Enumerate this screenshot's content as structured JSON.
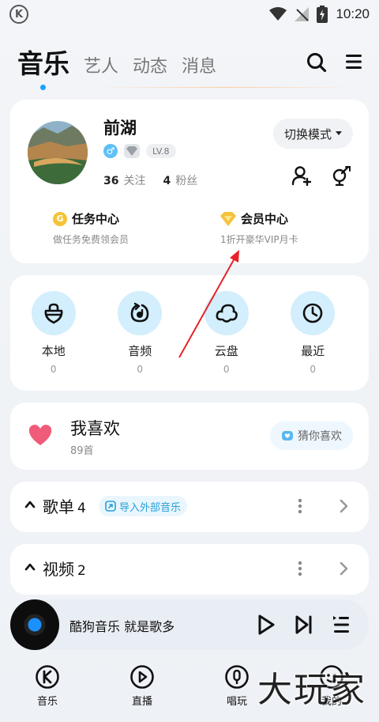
{
  "status_bar": {
    "time": "10:20"
  },
  "top_tabs": {
    "active": "音乐",
    "others": [
      "艺人",
      "动态",
      "消息"
    ]
  },
  "profile": {
    "username": "前湖",
    "level": "LV.8",
    "following_count": "36",
    "following_label": "关注",
    "fans_count": "4",
    "fans_label": "粉丝",
    "mode_button": "切换模式",
    "tasks": [
      {
        "title": "任务中心",
        "subtitle": "做任务免费领会员",
        "icon": "coin-icon"
      },
      {
        "title": "会员中心",
        "subtitle": "1折开豪华VIP月卡",
        "icon": "diamond-icon"
      }
    ]
  },
  "quick_access": [
    {
      "label": "本地",
      "count": "0",
      "icon": "bag-icon"
    },
    {
      "label": "音频",
      "count": "0",
      "icon": "audio-icon"
    },
    {
      "label": "云盘",
      "count": "0",
      "icon": "cloud-icon"
    },
    {
      "label": "最近",
      "count": "0",
      "icon": "clock-icon"
    }
  ],
  "favorites": {
    "title": "我喜欢",
    "count": "89首",
    "guess_button": "猜你喜欢"
  },
  "song_list": {
    "title": "歌单",
    "count": "4",
    "import_label": "导入外部音乐"
  },
  "video": {
    "title": "视频",
    "count": "2"
  },
  "player": {
    "title": "酷狗音乐  就是歌多"
  },
  "bottom_nav": [
    {
      "label": "音乐",
      "icon": "kugou-icon"
    },
    {
      "label": "直播",
      "icon": "live-icon"
    },
    {
      "label": "唱玩",
      "icon": "mic-icon"
    },
    {
      "label": "我的",
      "icon": "profile-icon"
    }
  ],
  "watermark": "大玩家",
  "colors": {
    "accent": "#1aa0ff",
    "icon_bg": "#d3eefc",
    "heart": "#f05b79",
    "annotation": "#e8222a"
  }
}
